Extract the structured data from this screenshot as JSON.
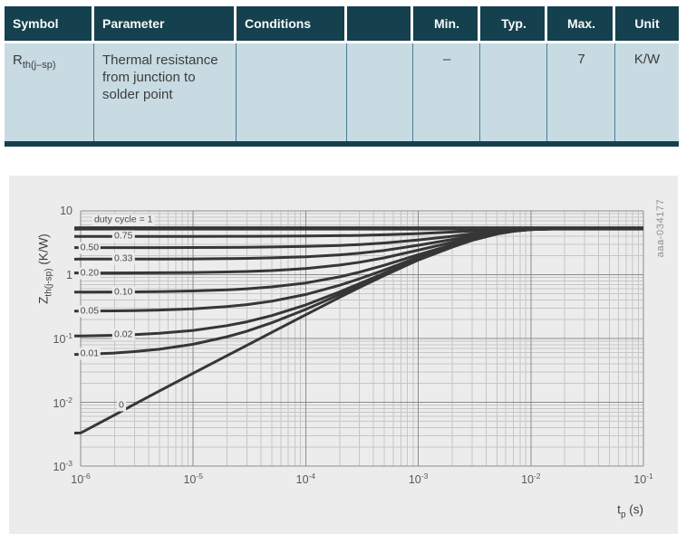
{
  "table": {
    "header": [
      "Symbol",
      "Parameter",
      "Conditions",
      "",
      "Min.",
      "Typ.",
      "Max.",
      "Unit"
    ],
    "row": {
      "symbol_base": "R",
      "symbol_sub": "th(j–sp)",
      "parameter": "Thermal resistance from junction to solder point",
      "conditions": "",
      "extra": "",
      "min": "–",
      "typ": "",
      "max": "7",
      "unit": "K/W"
    },
    "colors": {
      "header_bg": "#15404d",
      "header_text": "#f7fafb",
      "row_bg": "#c8dbe3",
      "separator": "#4a7d92",
      "bottom_border": "#15404d",
      "body_text": "#3c3c3c"
    }
  },
  "chart": {
    "figure_id": "aaa-034177",
    "y_axis": {
      "main": "Z",
      "sub": "th(j-sp)",
      "rest": " (K/W)"
    },
    "x_axis": {
      "main": "t",
      "sub": "p",
      "rest": " (s)"
    },
    "colors": {
      "panel_bg": "#ececec",
      "grid_minor": "#c6c6c6",
      "grid_major": "#8c8c8c",
      "curve": "#363636",
      "curve_label_text": "#4a4a4a",
      "tick_text": "#57575a",
      "axis_title_text": "#3f3f3f",
      "watermark_text": "#8f8f8f"
    }
  },
  "chart_data": {
    "type": "line",
    "title": "",
    "xlabel": "tp (s)",
    "ylabel": "Zth(j-sp) (K/W)",
    "x_scale": "log",
    "y_scale": "log",
    "x_log_range": [
      -6,
      -1
    ],
    "y_log_range": [
      -3,
      1
    ],
    "grid": "log major+minor",
    "x_ticks": [
      {
        "base": "10",
        "exp": "-6",
        "log": -6
      },
      {
        "base": "10",
        "exp": "-5",
        "log": -5
      },
      {
        "base": "10",
        "exp": "-4",
        "log": -4
      },
      {
        "base": "10",
        "exp": "-3",
        "log": -3
      },
      {
        "base": "10",
        "exp": "-2",
        "log": -2
      },
      {
        "base": "10",
        "exp": "-1",
        "log": -1
      }
    ],
    "y_ticks": [
      {
        "base": "10",
        "exp": null,
        "log": 1
      },
      {
        "base": "1",
        "exp": null,
        "log": 0
      },
      {
        "base": "10",
        "exp": "-1",
        "log": -1
      },
      {
        "base": "10",
        "exp": "-2",
        "log": -2
      },
      {
        "base": "10",
        "exp": "-3",
        "log": -3
      }
    ],
    "t": [
      1e-06,
      2e-06,
      3e-06,
      5e-06,
      1e-05,
      2e-05,
      3e-05,
      5e-05,
      0.0001,
      0.0002,
      0.0003,
      0.0005,
      0.001,
      0.002,
      0.003,
      0.005,
      0.007,
      0.01,
      0.02,
      0.05,
      0.1
    ],
    "steady_state_zth": 5.3,
    "series": [
      {
        "label": "duty cycle = 1",
        "duty": 1.0,
        "label_t": 2.4e-06,
        "label_dy": -9,
        "values": [
          5.3,
          5.3,
          5.3,
          5.3,
          5.3,
          5.3,
          5.3,
          5.3,
          5.3,
          5.3,
          5.3,
          5.3,
          5.3,
          5.3,
          5.3,
          5.3,
          5.3,
          5.3,
          5.3,
          5.3,
          5.3
        ]
      },
      {
        "label": "0.75",
        "duty": 0.75,
        "label_t": 2.4e-06,
        "label_dy": 0,
        "values": [
          3.976,
          3.977,
          3.977,
          3.979,
          3.982,
          3.989,
          3.995,
          4.006,
          4.034,
          4.085,
          4.133,
          4.218,
          4.4,
          4.65,
          4.838,
          5.063,
          5.175,
          5.25,
          5.29,
          5.3,
          5.3
        ]
      },
      {
        "label": "0.50",
        "duty": 0.5,
        "label_t": 1.2e-06,
        "label_dy": 0,
        "values": [
          2.652,
          2.653,
          2.655,
          2.658,
          2.664,
          2.677,
          2.689,
          2.713,
          2.768,
          2.87,
          2.965,
          3.135,
          3.5,
          4.0,
          4.375,
          4.825,
          5.05,
          5.2,
          5.29,
          5.3,
          5.3
        ]
      },
      {
        "label": "0.33",
        "duty": 0.33,
        "label_t": 2.4e-06,
        "label_dy": 0,
        "values": [
          1.751,
          1.753,
          1.755,
          1.759,
          1.768,
          1.785,
          1.801,
          1.833,
          1.906,
          2.044,
          2.171,
          2.399,
          2.888,
          3.558,
          4.061,
          4.664,
          4.965,
          5.166,
          5.287,
          5.3,
          5.3
        ]
      },
      {
        "label": "0.20",
        "duty": 0.2,
        "label_t": 1.2e-06,
        "label_dy": 0,
        "values": [
          1.063,
          1.065,
          1.067,
          1.072,
          1.083,
          1.103,
          1.122,
          1.16,
          1.248,
          1.412,
          1.564,
          1.836,
          2.42,
          3.22,
          3.82,
          4.54,
          4.9,
          5.14,
          5.284,
          5.3,
          5.3
        ]
      },
      {
        "label": "0.10",
        "duty": 0.1,
        "label_t": 2.4e-06,
        "label_dy": 0,
        "values": [
          0.533,
          0.5357,
          0.5384,
          0.5435,
          0.5557,
          0.5786,
          0.6002,
          0.6425,
          0.7415,
          0.926,
          1.097,
          1.403,
          2.06,
          2.96,
          3.635,
          4.445,
          4.85,
          5.12,
          5.282,
          5.3,
          5.3
        ]
      },
      {
        "label": "0.05",
        "duty": 0.05,
        "label_t": 1.2e-06,
        "label_dy": 0,
        "values": [
          0.2681,
          0.271,
          0.2738,
          0.2793,
          0.2921,
          0.3163,
          0.3391,
          0.3838,
          0.4883,
          0.683,
          0.8635,
          1.187,
          1.88,
          2.83,
          3.543,
          4.398,
          4.825,
          5.11,
          5.281,
          5.3,
          5.3
        ]
      },
      {
        "label": "0.02",
        "duty": 0.02,
        "label_t": 2.4e-06,
        "label_dy": 0,
        "values": [
          0.1092,
          0.1122,
          0.1151,
          0.1207,
          0.1339,
          0.1589,
          0.1824,
          0.2285,
          0.3363,
          0.5372,
          0.7234,
          1.057,
          1.772,
          2.752,
          3.487,
          4.369,
          4.81,
          5.104,
          5.28,
          5.3,
          5.3
        ]
      },
      {
        "label": "0.01",
        "duty": 0.01,
        "label_t": 1.2e-06,
        "label_dy": 0,
        "values": [
          0.0563,
          0.0592,
          0.0622,
          0.0679,
          0.0812,
          0.1065,
          0.1302,
          0.1768,
          0.2857,
          0.4886,
          0.6767,
          1.013,
          1.736,
          2.726,
          3.469,
          4.36,
          4.805,
          5.102,
          5.28,
          5.3,
          5.3
        ]
      },
      {
        "label": "0",
        "duty": 0,
        "label_t": 2.3e-06,
        "label_dy": -7,
        "values": [
          0.0033,
          0.0063,
          0.0093,
          0.015,
          0.0285,
          0.054,
          0.078,
          0.125,
          0.235,
          0.44,
          0.63,
          0.97,
          1.7,
          2.7,
          3.45,
          4.35,
          4.8,
          5.1,
          5.28,
          5.3,
          5.3
        ]
      }
    ],
    "legend_position": "labels on curves"
  }
}
